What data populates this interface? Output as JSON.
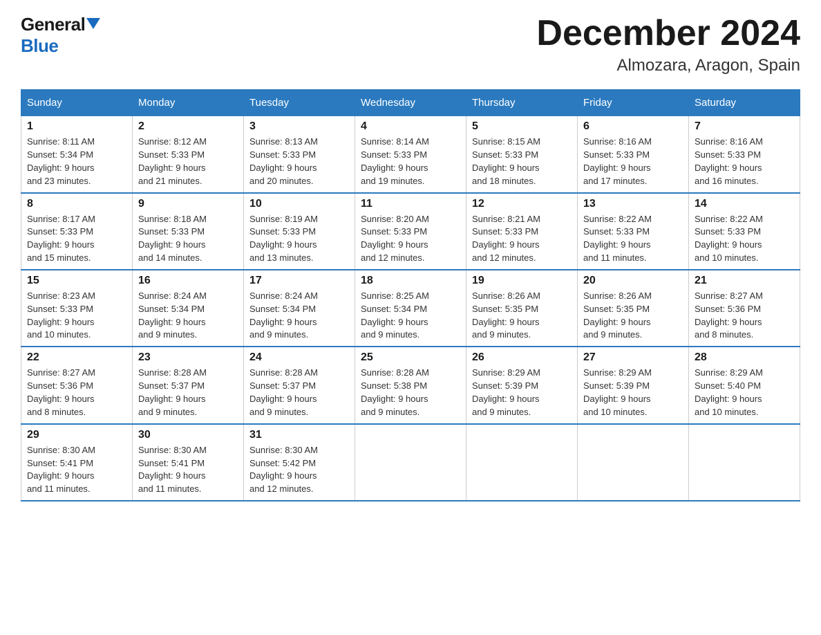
{
  "header": {
    "logo_general": "General",
    "logo_blue": "Blue",
    "title": "December 2024",
    "subtitle": "Almozara, Aragon, Spain"
  },
  "days_of_week": [
    "Sunday",
    "Monday",
    "Tuesday",
    "Wednesday",
    "Thursday",
    "Friday",
    "Saturday"
  ],
  "weeks": [
    [
      {
        "day": "1",
        "sunrise": "8:11 AM",
        "sunset": "5:34 PM",
        "daylight": "9 hours and 23 minutes."
      },
      {
        "day": "2",
        "sunrise": "8:12 AM",
        "sunset": "5:33 PM",
        "daylight": "9 hours and 21 minutes."
      },
      {
        "day": "3",
        "sunrise": "8:13 AM",
        "sunset": "5:33 PM",
        "daylight": "9 hours and 20 minutes."
      },
      {
        "day": "4",
        "sunrise": "8:14 AM",
        "sunset": "5:33 PM",
        "daylight": "9 hours and 19 minutes."
      },
      {
        "day": "5",
        "sunrise": "8:15 AM",
        "sunset": "5:33 PM",
        "daylight": "9 hours and 18 minutes."
      },
      {
        "day": "6",
        "sunrise": "8:16 AM",
        "sunset": "5:33 PM",
        "daylight": "9 hours and 17 minutes."
      },
      {
        "day": "7",
        "sunrise": "8:16 AM",
        "sunset": "5:33 PM",
        "daylight": "9 hours and 16 minutes."
      }
    ],
    [
      {
        "day": "8",
        "sunrise": "8:17 AM",
        "sunset": "5:33 PM",
        "daylight": "9 hours and 15 minutes."
      },
      {
        "day": "9",
        "sunrise": "8:18 AM",
        "sunset": "5:33 PM",
        "daylight": "9 hours and 14 minutes."
      },
      {
        "day": "10",
        "sunrise": "8:19 AM",
        "sunset": "5:33 PM",
        "daylight": "9 hours and 13 minutes."
      },
      {
        "day": "11",
        "sunrise": "8:20 AM",
        "sunset": "5:33 PM",
        "daylight": "9 hours and 12 minutes."
      },
      {
        "day": "12",
        "sunrise": "8:21 AM",
        "sunset": "5:33 PM",
        "daylight": "9 hours and 12 minutes."
      },
      {
        "day": "13",
        "sunrise": "8:22 AM",
        "sunset": "5:33 PM",
        "daylight": "9 hours and 11 minutes."
      },
      {
        "day": "14",
        "sunrise": "8:22 AM",
        "sunset": "5:33 PM",
        "daylight": "9 hours and 10 minutes."
      }
    ],
    [
      {
        "day": "15",
        "sunrise": "8:23 AM",
        "sunset": "5:33 PM",
        "daylight": "9 hours and 10 minutes."
      },
      {
        "day": "16",
        "sunrise": "8:24 AM",
        "sunset": "5:34 PM",
        "daylight": "9 hours and 9 minutes."
      },
      {
        "day": "17",
        "sunrise": "8:24 AM",
        "sunset": "5:34 PM",
        "daylight": "9 hours and 9 minutes."
      },
      {
        "day": "18",
        "sunrise": "8:25 AM",
        "sunset": "5:34 PM",
        "daylight": "9 hours and 9 minutes."
      },
      {
        "day": "19",
        "sunrise": "8:26 AM",
        "sunset": "5:35 PM",
        "daylight": "9 hours and 9 minutes."
      },
      {
        "day": "20",
        "sunrise": "8:26 AM",
        "sunset": "5:35 PM",
        "daylight": "9 hours and 9 minutes."
      },
      {
        "day": "21",
        "sunrise": "8:27 AM",
        "sunset": "5:36 PM",
        "daylight": "9 hours and 8 minutes."
      }
    ],
    [
      {
        "day": "22",
        "sunrise": "8:27 AM",
        "sunset": "5:36 PM",
        "daylight": "9 hours and 8 minutes."
      },
      {
        "day": "23",
        "sunrise": "8:28 AM",
        "sunset": "5:37 PM",
        "daylight": "9 hours and 9 minutes."
      },
      {
        "day": "24",
        "sunrise": "8:28 AM",
        "sunset": "5:37 PM",
        "daylight": "9 hours and 9 minutes."
      },
      {
        "day": "25",
        "sunrise": "8:28 AM",
        "sunset": "5:38 PM",
        "daylight": "9 hours and 9 minutes."
      },
      {
        "day": "26",
        "sunrise": "8:29 AM",
        "sunset": "5:39 PM",
        "daylight": "9 hours and 9 minutes."
      },
      {
        "day": "27",
        "sunrise": "8:29 AM",
        "sunset": "5:39 PM",
        "daylight": "9 hours and 10 minutes."
      },
      {
        "day": "28",
        "sunrise": "8:29 AM",
        "sunset": "5:40 PM",
        "daylight": "9 hours and 10 minutes."
      }
    ],
    [
      {
        "day": "29",
        "sunrise": "8:30 AM",
        "sunset": "5:41 PM",
        "daylight": "9 hours and 11 minutes."
      },
      {
        "day": "30",
        "sunrise": "8:30 AM",
        "sunset": "5:41 PM",
        "daylight": "9 hours and 11 minutes."
      },
      {
        "day": "31",
        "sunrise": "8:30 AM",
        "sunset": "5:42 PM",
        "daylight": "9 hours and 12 minutes."
      },
      null,
      null,
      null,
      null
    ]
  ],
  "labels": {
    "sunrise": "Sunrise:",
    "sunset": "Sunset:",
    "daylight": "Daylight:"
  }
}
